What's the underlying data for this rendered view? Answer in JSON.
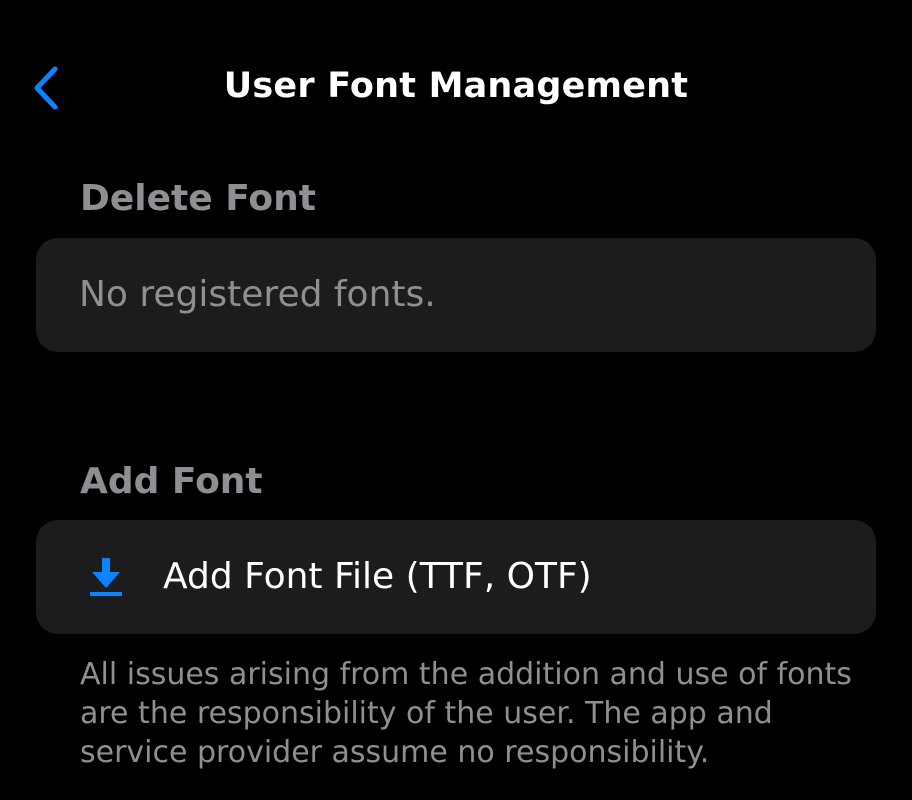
{
  "nav": {
    "title": "User Font Management",
    "back_icon": "chevron-left-icon"
  },
  "delete_section": {
    "header": "Delete Font",
    "empty_message": "No registered fonts."
  },
  "add_section": {
    "header": "Add Font",
    "add_button_icon": "download-icon",
    "add_button_label": "Add Font File (TTF, OTF)"
  },
  "footer": {
    "disclaimer": "All issues arising from the addition and use of fonts are the responsibility of the user. The app and service provider assume no responsibility."
  },
  "colors": {
    "background": "#000000",
    "cell_background": "#1c1c1e",
    "accent": "#0a84ff",
    "secondary_text": "#8e8e93",
    "primary_text": "#ffffff"
  }
}
